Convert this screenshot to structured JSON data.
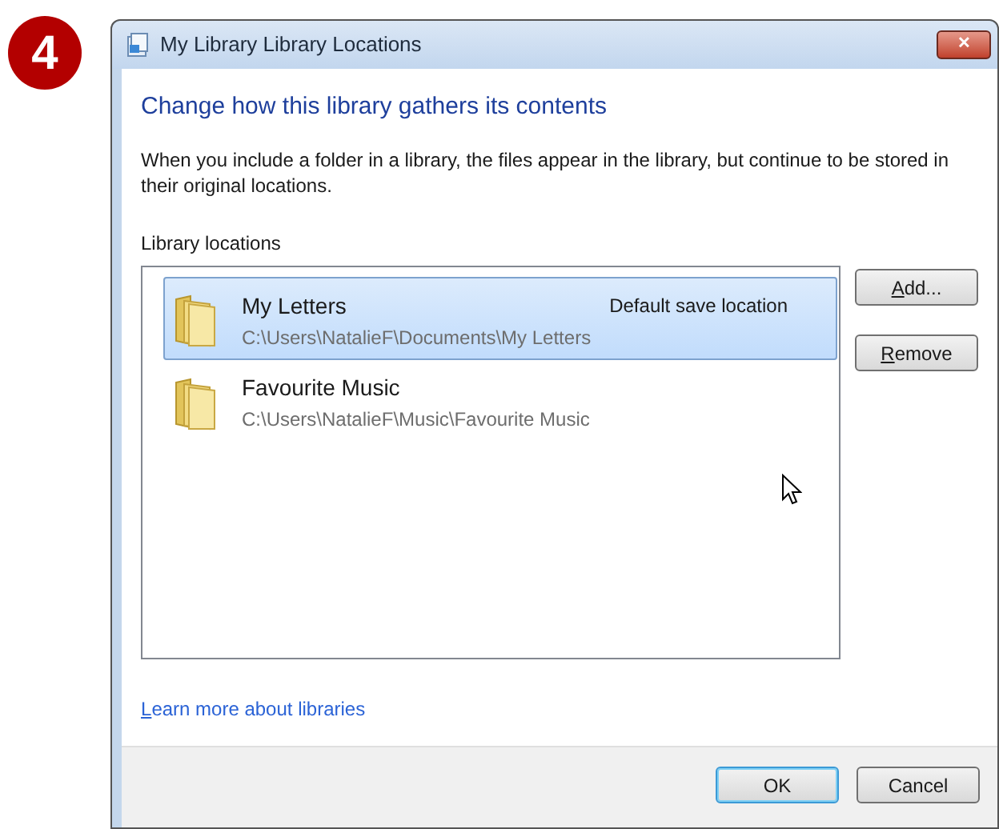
{
  "step_badge": "4",
  "window": {
    "title": "My Library Library Locations",
    "close": "✕"
  },
  "heading": "Change how this library gathers its contents",
  "description": "When you include a folder in a library, the files appear in the library, but continue to be stored in their original locations.",
  "locations_label": "Library locations",
  "locations": [
    {
      "name": "My Letters",
      "path": "C:\\Users\\NatalieF\\Documents\\My Letters",
      "note": "Default save location",
      "selected": true
    },
    {
      "name": "Favourite Music",
      "path": "C:\\Users\\NatalieF\\Music\\Favourite Music",
      "selected": false
    }
  ],
  "side_buttons": [
    {
      "label": "Add...",
      "underline_first": true
    },
    {
      "label": "Remove",
      "underline_first": true
    }
  ],
  "link": {
    "label": "Learn more about libraries",
    "underline_first": true
  },
  "footer_buttons": [
    {
      "label": "OK",
      "default": true,
      "underline_first": false
    },
    {
      "label": "Cancel",
      "default": false,
      "underline_first": false
    }
  ]
}
